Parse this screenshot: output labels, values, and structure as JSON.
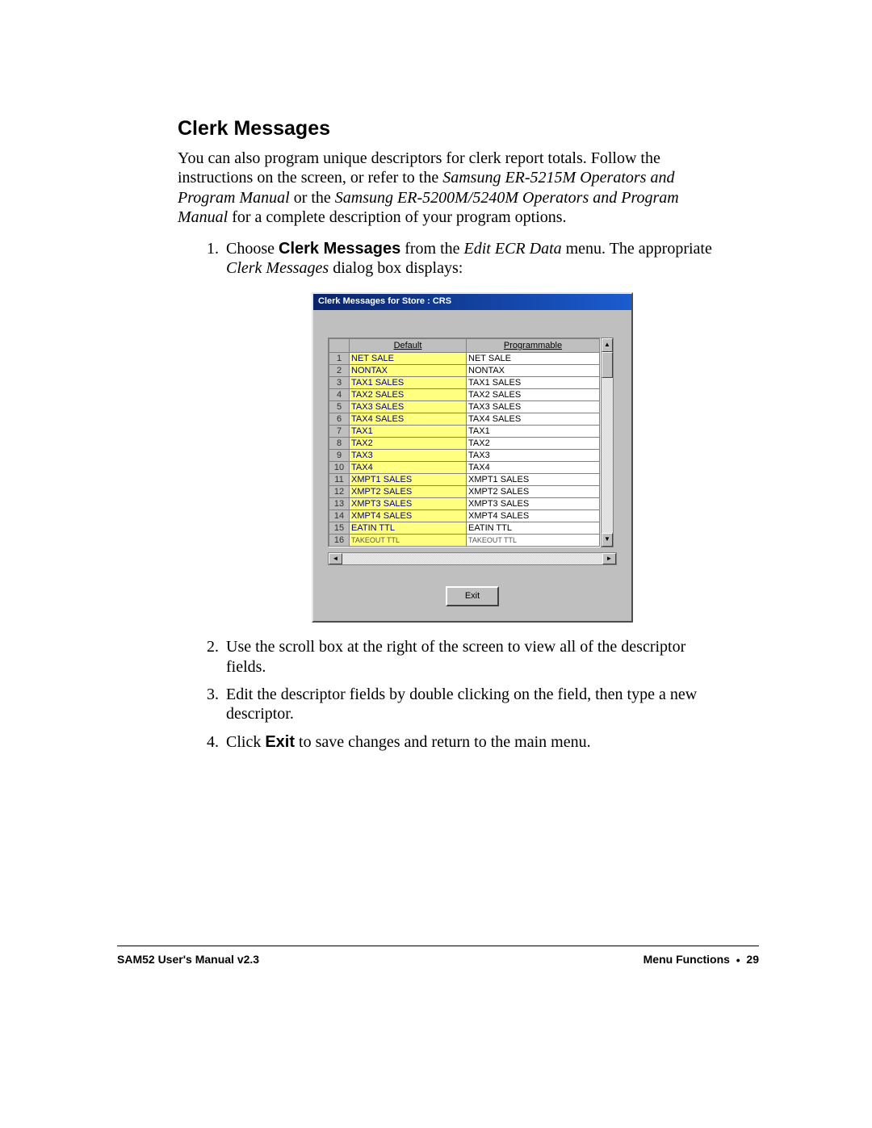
{
  "heading": "Clerk Messages",
  "intro_parts": {
    "p1a": "You can also program unique descriptors for clerk report totals.  Follow the instructions on the screen, or refer to the ",
    "p1b": "Samsung ER-5215M Operators and Program Manual",
    "p1c": " or the ",
    "p1d": "Samsung ER-5200M/5240M Operators and Program Manual",
    "p1e": " for a complete description of your program options."
  },
  "steps": {
    "s1a": "Choose ",
    "s1b": "Clerk Messages",
    "s1c": " from the ",
    "s1d": "Edit ECR Data",
    "s1e": " menu.  The appropriate ",
    "s1f": "Clerk Messages",
    "s1g": " dialog box displays:",
    "s2": "Use the scroll box at the right of the screen to view all of the descriptor fields.",
    "s3": "Edit the descriptor fields by double clicking on the field, then type a new descriptor.",
    "s4a": "Click ",
    "s4b": "Exit",
    "s4c": " to save changes and return to the main menu."
  },
  "dialog": {
    "title": "Clerk Messages for Store :   CRS",
    "columns": {
      "c1": "Default",
      "c2": "Programmable"
    },
    "rows": [
      {
        "n": "1",
        "d": "NET SALE",
        "p": "NET SALE"
      },
      {
        "n": "2",
        "d": "NONTAX",
        "p": "NONTAX"
      },
      {
        "n": "3",
        "d": "TAX1 SALES",
        "p": "TAX1 SALES"
      },
      {
        "n": "4",
        "d": "TAX2 SALES",
        "p": "TAX2 SALES"
      },
      {
        "n": "5",
        "d": "TAX3 SALES",
        "p": "TAX3 SALES"
      },
      {
        "n": "6",
        "d": "TAX4 SALES",
        "p": "TAX4 SALES"
      },
      {
        "n": "7",
        "d": "TAX1",
        "p": "TAX1"
      },
      {
        "n": "8",
        "d": "TAX2",
        "p": "TAX2"
      },
      {
        "n": "9",
        "d": "TAX3",
        "p": "TAX3"
      },
      {
        "n": "10",
        "d": "TAX4",
        "p": "TAX4"
      },
      {
        "n": "11",
        "d": "XMPT1 SALES",
        "p": "XMPT1 SALES"
      },
      {
        "n": "12",
        "d": "XMPT2 SALES",
        "p": "XMPT2 SALES"
      },
      {
        "n": "13",
        "d": "XMPT3 SALES",
        "p": "XMPT3 SALES"
      },
      {
        "n": "14",
        "d": "XMPT4 SALES",
        "p": "XMPT4 SALES"
      },
      {
        "n": "15",
        "d": "EATIN TTL",
        "p": "EATIN TTL"
      },
      {
        "n": "16",
        "d": "TAKEOUT TTL",
        "p": "TAKEOUT TTL"
      }
    ],
    "exit_label": "Exit"
  },
  "footer": {
    "left": "SAM52 User's Manual v2.3",
    "right_section": "Menu Functions",
    "bullet": "•",
    "page": "29"
  }
}
